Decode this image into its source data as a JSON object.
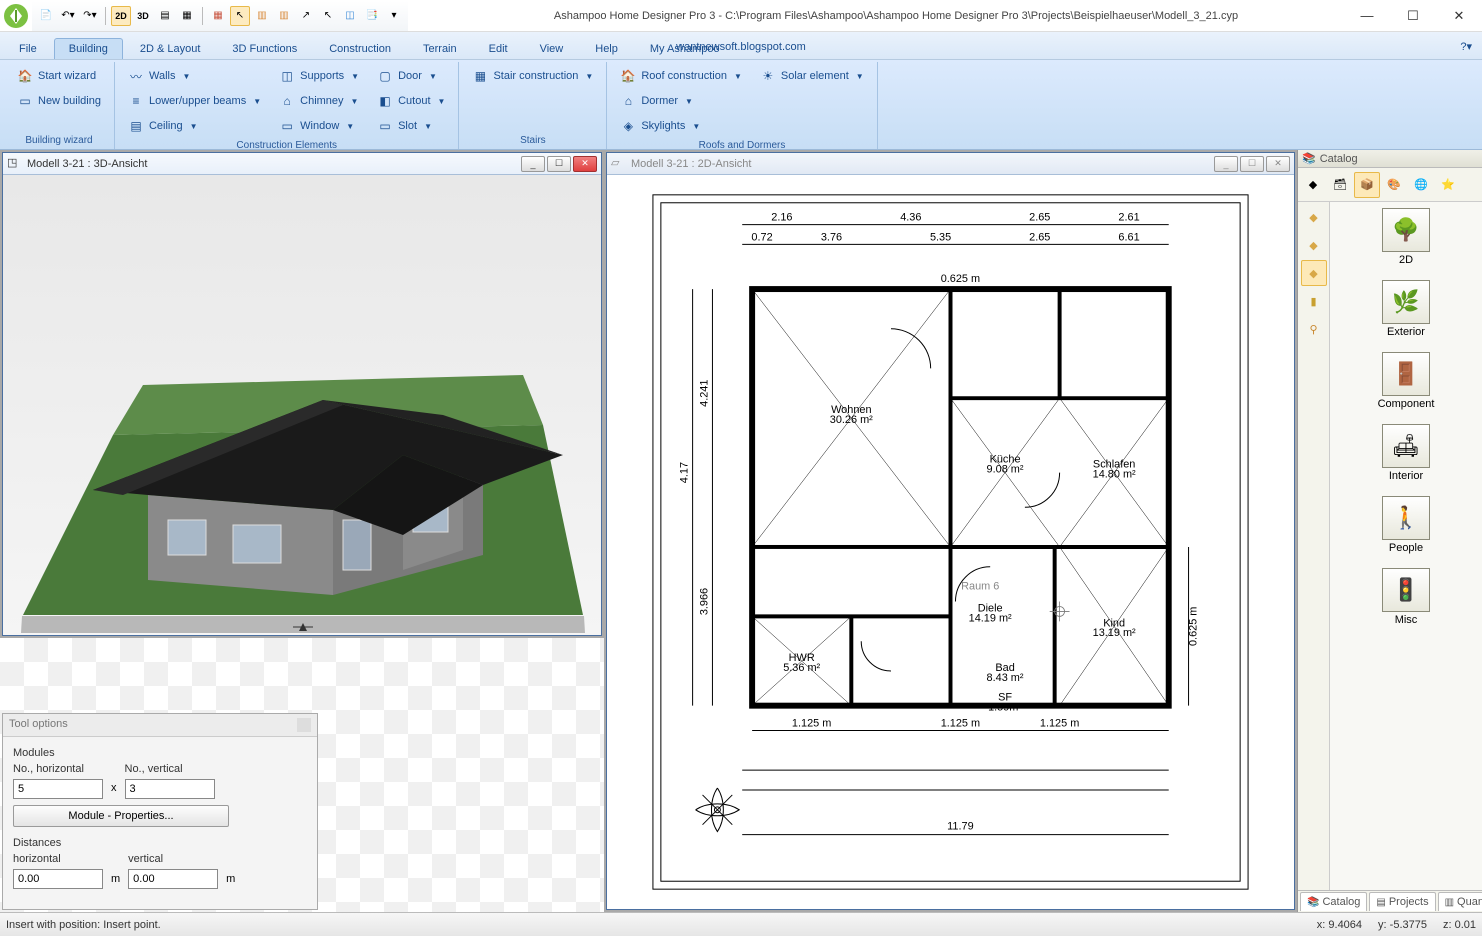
{
  "window": {
    "title": "Ashampoo Home Designer Pro 3 - C:\\Program Files\\Ashampoo\\Ashampoo Home Designer Pro 3\\Projects\\Beispielhaeuser\\Modell_3_21.cyp"
  },
  "qat": {
    "items": [
      "new",
      "undo",
      "redo",
      "sep",
      "2d",
      "3d",
      "grid1",
      "grid2",
      "sep",
      "snap1",
      "cursor",
      "dim1",
      "dim2",
      "guide",
      "cursor2",
      "measure",
      "catalog",
      "sep"
    ]
  },
  "tabs": {
    "items": [
      "File",
      "Building",
      "2D & Layout",
      "3D Functions",
      "Construction",
      "Terrain",
      "Edit",
      "View",
      "Help",
      "My Ashampoo"
    ],
    "active": 1,
    "blog": "wantnewsoft.blogspot.com"
  },
  "ribbon": {
    "groups": [
      {
        "title": "Building wizard",
        "cols": [
          [
            {
              "icon": "🏠",
              "label": "Start wizard",
              "dd": false
            },
            {
              "icon": "▭",
              "label": "New building",
              "dd": false
            }
          ]
        ]
      },
      {
        "title": "Construction Elements",
        "cols": [
          [
            {
              "icon": "〰",
              "label": "Walls",
              "dd": true
            },
            {
              "icon": "≡",
              "label": "Lower/upper beams",
              "dd": true
            },
            {
              "icon": "▤",
              "label": "Ceiling",
              "dd": true
            }
          ],
          [
            {
              "icon": "◫",
              "label": "Supports",
              "dd": true
            },
            {
              "icon": "⌂",
              "label": "Chimney",
              "dd": true
            },
            {
              "icon": "▭",
              "label": "Window",
              "dd": true
            }
          ],
          [
            {
              "icon": "▢",
              "label": "Door",
              "dd": true
            },
            {
              "icon": "◧",
              "label": "Cutout",
              "dd": true
            },
            {
              "icon": "▭",
              "label": "Slot",
              "dd": true
            }
          ]
        ]
      },
      {
        "title": "Stairs",
        "cols": [
          [
            {
              "icon": "▦",
              "label": "Stair construction",
              "dd": true
            }
          ]
        ]
      },
      {
        "title": "Roofs and Dormers",
        "cols": [
          [
            {
              "icon": "🏠",
              "label": "Roof construction",
              "dd": true
            },
            {
              "icon": "⌂",
              "label": "Dormer",
              "dd": true
            },
            {
              "icon": "◈",
              "label": "Skylights",
              "dd": true
            }
          ],
          [
            {
              "icon": "☀",
              "label": "Solar element",
              "dd": true
            }
          ]
        ]
      }
    ]
  },
  "views": {
    "left_title": "Modell 3-21 : 3D-Ansicht",
    "right_title": "Modell 3-21 : 2D-Ansicht"
  },
  "floorplan": {
    "rooms": [
      {
        "name": "Wohnen",
        "area": "30.26 m²"
      },
      {
        "name": "Küche",
        "area": "9.08 m²"
      },
      {
        "name": "Schlafen",
        "area": "14.80 m²"
      },
      {
        "name": "Diele",
        "area": "14.19 m²"
      },
      {
        "name": "HWR",
        "area": "5.36 m²"
      },
      {
        "name": "Bad",
        "area": "8.43 m²"
      },
      {
        "name": "Kind",
        "area": "13.19 m²"
      },
      {
        "name": "Raum 6",
        "area": ""
      }
    ],
    "dims_top": [
      "2.16",
      "4.36",
      "2.65",
      "2.61"
    ],
    "dims_top2": [
      "0.72",
      "3.76",
      "5.35",
      "2.65",
      "6.61"
    ],
    "dims_bottom": [
      "1.125 m",
      "1.125 m",
      "1.125 m"
    ],
    "dim_label": "0.625 m",
    "sf_label": "SF 1.59m²",
    "dims_bottom2": "11.79",
    "dim_right": "0.625 m",
    "dims_left": [
      "4.17",
      "4.241",
      "3.966"
    ]
  },
  "catalog": {
    "title": "Catalog",
    "toolbtns": [
      "box",
      "db",
      "cube",
      "mat",
      "globe",
      "fav"
    ],
    "sidebtns": [
      "◆",
      "◆",
      "◆",
      "◇",
      "▮",
      "⚲"
    ],
    "items": [
      "2D",
      "Exterior",
      "Component",
      "Interior",
      "People",
      "Misc"
    ],
    "tabs": [
      "Catalog",
      "Projects",
      "Quantities"
    ]
  },
  "tool_options": {
    "title": "Tool options",
    "modules_label": "Modules",
    "nh_label": "No., horizontal",
    "nv_label": "No., vertical",
    "nh_value": "5",
    "nv_value": "3",
    "x_label": "x",
    "prop_btn": "Module - Properties...",
    "dist_label": "Distances",
    "dh_label": "horizontal",
    "dv_label": "vertical",
    "dh_value": "0.00",
    "dv_value": "0.00",
    "m_unit": "m"
  },
  "status": {
    "msg": "Insert with position: Insert point.",
    "x": "x: 9.4064",
    "y": "y: -5.3775",
    "z": "z: 0.01"
  }
}
